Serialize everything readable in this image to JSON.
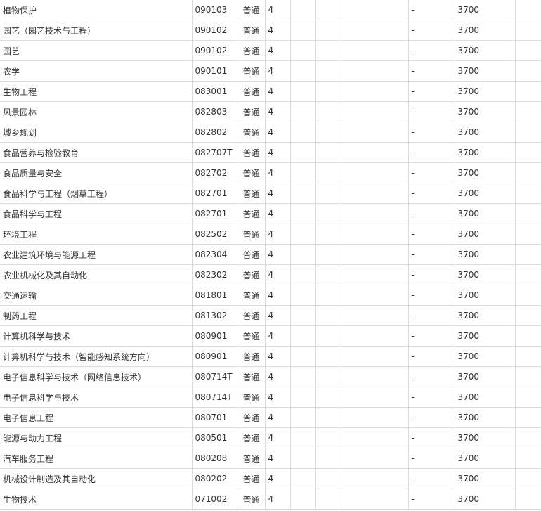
{
  "rows": [
    {
      "name": "植物保护",
      "code": "090103",
      "type": "普通",
      "years": "4",
      "c5": "",
      "c6": "",
      "c7": "",
      "c8": "-",
      "fee": "3700",
      "c10": ""
    },
    {
      "name": "园艺（园艺技术与工程）",
      "code": "090102",
      "type": "普通",
      "years": "4",
      "c5": "",
      "c6": "",
      "c7": "",
      "c8": "-",
      "fee": "3700",
      "c10": ""
    },
    {
      "name": "园艺",
      "code": "090102",
      "type": "普通",
      "years": "4",
      "c5": "",
      "c6": "",
      "c7": "",
      "c8": "-",
      "fee": "3700",
      "c10": ""
    },
    {
      "name": "农学",
      "code": "090101",
      "type": "普通",
      "years": "4",
      "c5": "",
      "c6": "",
      "c7": "",
      "c8": "-",
      "fee": "3700",
      "c10": ""
    },
    {
      "name": "生物工程",
      "code": "083001",
      "type": "普通",
      "years": "4",
      "c5": "",
      "c6": "",
      "c7": "",
      "c8": "-",
      "fee": "3700",
      "c10": ""
    },
    {
      "name": "风景园林",
      "code": "082803",
      "type": "普通",
      "years": "4",
      "c5": "",
      "c6": "",
      "c7": "",
      "c8": "-",
      "fee": "3700",
      "c10": ""
    },
    {
      "name": "城乡规划",
      "code": "082802",
      "type": "普通",
      "years": "4",
      "c5": "",
      "c6": "",
      "c7": "",
      "c8": "-",
      "fee": "3700",
      "c10": ""
    },
    {
      "name": "食品营养与检验教育",
      "code": "082707T",
      "type": "普通",
      "years": "4",
      "c5": "",
      "c6": "",
      "c7": "",
      "c8": "-",
      "fee": "3700",
      "c10": ""
    },
    {
      "name": "食品质量与安全",
      "code": "082702",
      "type": "普通",
      "years": "4",
      "c5": "",
      "c6": "",
      "c7": "",
      "c8": "-",
      "fee": "3700",
      "c10": ""
    },
    {
      "name": "食品科学与工程（烟草工程）",
      "code": "082701",
      "type": "普通",
      "years": "4",
      "c5": "",
      "c6": "",
      "c7": "",
      "c8": "-",
      "fee": "3700",
      "c10": ""
    },
    {
      "name": "食品科学与工程",
      "code": "082701",
      "type": "普通",
      "years": "4",
      "c5": "",
      "c6": "",
      "c7": "",
      "c8": "-",
      "fee": "3700",
      "c10": ""
    },
    {
      "name": "环境工程",
      "code": "082502",
      "type": "普通",
      "years": "4",
      "c5": "",
      "c6": "",
      "c7": "",
      "c8": "-",
      "fee": "3700",
      "c10": ""
    },
    {
      "name": "农业建筑环境与能源工程",
      "code": "082304",
      "type": "普通",
      "years": "4",
      "c5": "",
      "c6": "",
      "c7": "",
      "c8": "-",
      "fee": "3700",
      "c10": ""
    },
    {
      "name": "农业机械化及其自动化",
      "code": "082302",
      "type": "普通",
      "years": "4",
      "c5": "",
      "c6": "",
      "c7": "",
      "c8": "-",
      "fee": "3700",
      "c10": ""
    },
    {
      "name": "交通运输",
      "code": "081801",
      "type": "普通",
      "years": "4",
      "c5": "",
      "c6": "",
      "c7": "",
      "c8": "-",
      "fee": "3700",
      "c10": ""
    },
    {
      "name": "制药工程",
      "code": "081302",
      "type": "普通",
      "years": "4",
      "c5": "",
      "c6": "",
      "c7": "",
      "c8": "-",
      "fee": "3700",
      "c10": ""
    },
    {
      "name": "计算机科学与技术",
      "code": "080901",
      "type": "普通",
      "years": "4",
      "c5": "",
      "c6": "",
      "c7": "",
      "c8": "-",
      "fee": "3700",
      "c10": ""
    },
    {
      "name": "计算机科学与技术（智能感知系统方向）",
      "code": "080901",
      "type": "普通",
      "years": "4",
      "c5": "",
      "c6": "",
      "c7": "",
      "c8": "-",
      "fee": "3700",
      "c10": ""
    },
    {
      "name": "电子信息科学与技术（网络信息技术）",
      "code": "080714T",
      "type": "普通",
      "years": "4",
      "c5": "",
      "c6": "",
      "c7": "",
      "c8": "-",
      "fee": "3700",
      "c10": ""
    },
    {
      "name": "电子信息科学与技术",
      "code": "080714T",
      "type": "普通",
      "years": "4",
      "c5": "",
      "c6": "",
      "c7": "",
      "c8": "-",
      "fee": "3700",
      "c10": ""
    },
    {
      "name": "电子信息工程",
      "code": "080701",
      "type": "普通",
      "years": "4",
      "c5": "",
      "c6": "",
      "c7": "",
      "c8": "-",
      "fee": "3700",
      "c10": ""
    },
    {
      "name": "能源与动力工程",
      "code": "080501",
      "type": "普通",
      "years": "4",
      "c5": "",
      "c6": "",
      "c7": "",
      "c8": "-",
      "fee": "3700",
      "c10": ""
    },
    {
      "name": "汽车服务工程",
      "code": "080208",
      "type": "普通",
      "years": "4",
      "c5": "",
      "c6": "",
      "c7": "",
      "c8": "-",
      "fee": "3700",
      "c10": ""
    },
    {
      "name": "机械设计制造及其自动化",
      "code": "080202",
      "type": "普通",
      "years": "4",
      "c5": "",
      "c6": "",
      "c7": "",
      "c8": "-",
      "fee": "3700",
      "c10": ""
    },
    {
      "name": "生物技术",
      "code": "071002",
      "type": "普通",
      "years": "4",
      "c5": "",
      "c6": "",
      "c7": "",
      "c8": "-",
      "fee": "3700",
      "c10": ""
    }
  ]
}
